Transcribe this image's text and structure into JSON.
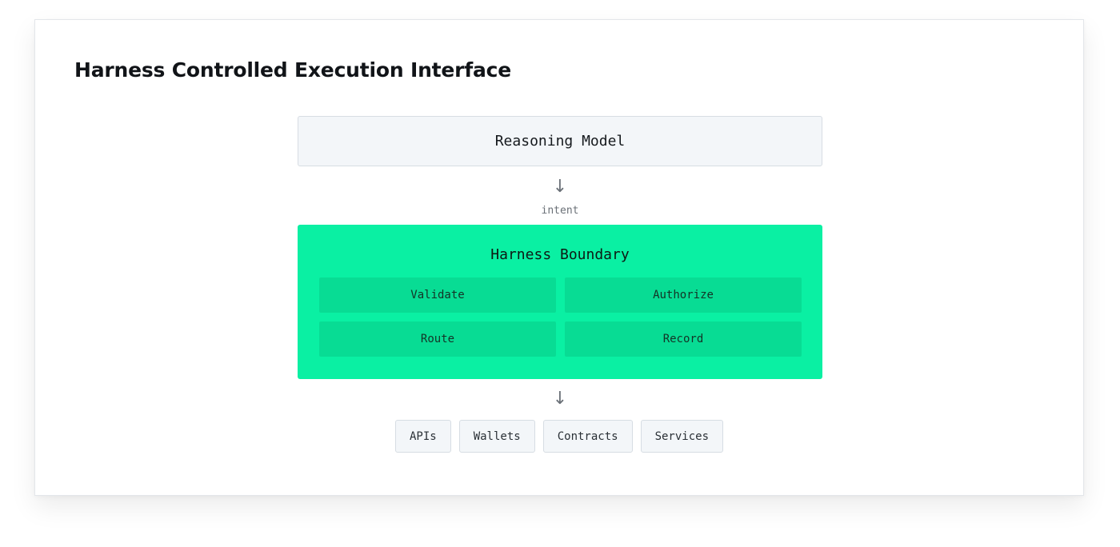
{
  "title": "Harness Controlled Execution Interface",
  "model": {
    "label": "Reasoning Model"
  },
  "arrows": {
    "glyph": "↓",
    "edge_label": "intent"
  },
  "boundary": {
    "title": "Harness Boundary",
    "steps": [
      "Validate",
      "Authorize",
      "Route",
      "Record"
    ],
    "color": "#0af0a3",
    "step_color": "#08dc94"
  },
  "targets": [
    "APIs",
    "Wallets",
    "Contracts",
    "Services"
  ]
}
